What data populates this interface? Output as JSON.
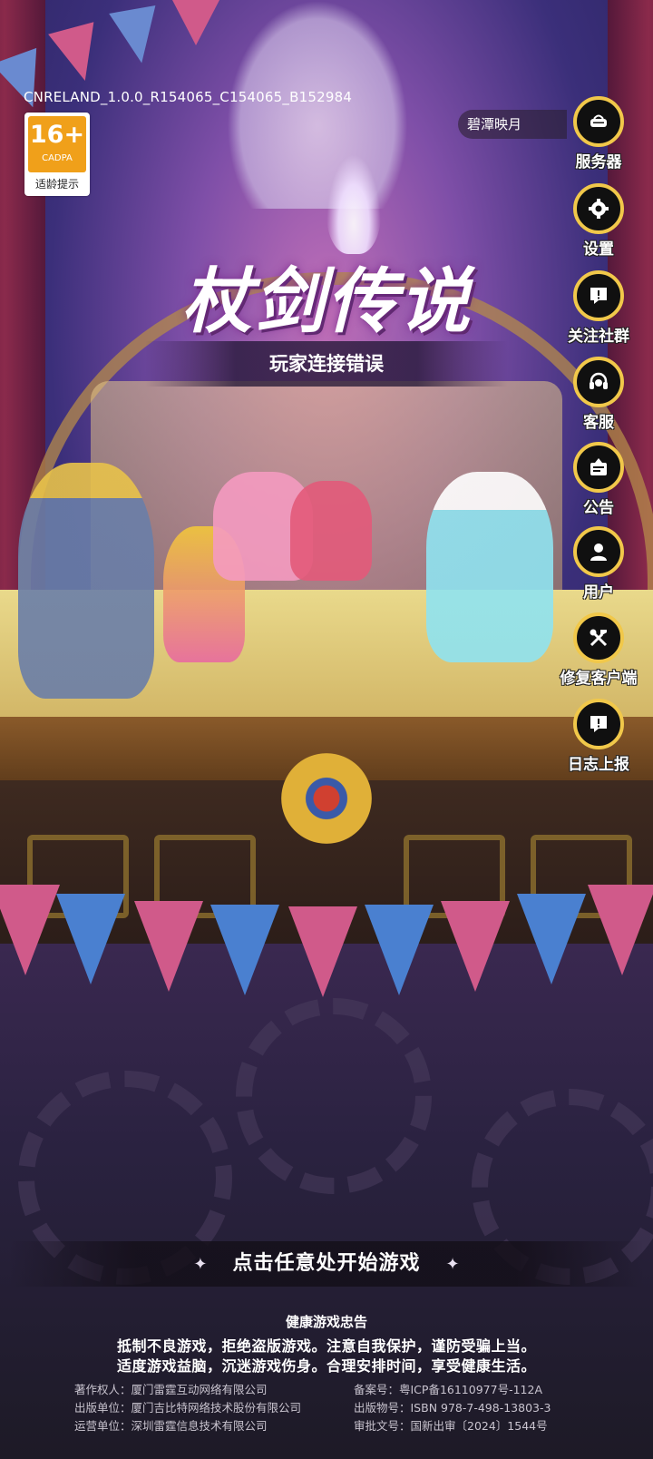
{
  "version": "CNRELAND_1.0.0_R154065_C154065_B152984",
  "age_rating": {
    "value": "16+",
    "org": "CADPA",
    "tip": "适龄提示"
  },
  "server_name": "碧潭映月",
  "side_menu": [
    {
      "label": "服务器",
      "icon": "server-icon"
    },
    {
      "label": "设置",
      "icon": "gear-icon"
    },
    {
      "label": "关注社群",
      "icon": "community-icon"
    },
    {
      "label": "客服",
      "icon": "headset-icon"
    },
    {
      "label": "公告",
      "icon": "notice-board-icon"
    },
    {
      "label": "用户",
      "icon": "user-icon"
    },
    {
      "label": "修复客户端",
      "icon": "repair-tools-icon"
    },
    {
      "label": "日志上报",
      "icon": "report-icon"
    }
  ],
  "logo_title": "杖剑传说",
  "error_message": "玩家连接错误",
  "start_prompt": "点击任意处开始游戏",
  "health_advice": {
    "title": "健康游戏忠告",
    "line1": "抵制不良游戏，拒绝盗版游戏。注意自我保护，谨防受骗上当。",
    "line2": "适度游戏益脑，沉迷游戏伤身。合理安排时间，享受健康生活。"
  },
  "credits_left": [
    "著作权人：厦门雷霆互动网络有限公司",
    "出版单位：厦门吉比特网络技术股份有限公司",
    "运营单位：深圳雷霆信息技术有限公司"
  ],
  "credits_right": [
    "备案号：粤ICP备16110977号-112A",
    "出版物号：ISBN 978-7-498-13803-3",
    "审批文号：国新出审〔2024〕1544号"
  ]
}
